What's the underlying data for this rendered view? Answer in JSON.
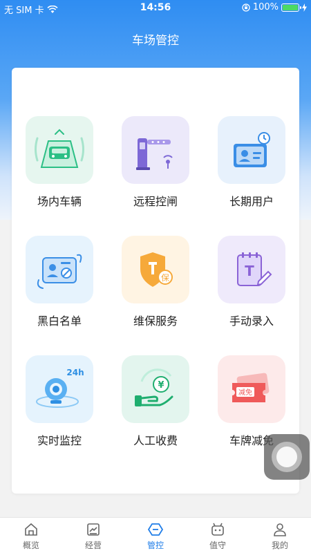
{
  "status_bar": {
    "carrier": "无 SIM 卡",
    "time": "14:56",
    "battery_percent": "100%",
    "battery_level": 1.0
  },
  "header": {
    "title": "车场管控"
  },
  "grid": [
    {
      "label": "场内车辆",
      "icon": "car-in-lot-icon",
      "color": "#e6f6ef"
    },
    {
      "label": "远程控闸",
      "icon": "remote-gate-icon",
      "color": "#ece9fa"
    },
    {
      "label": "长期用户",
      "icon": "long-term-user-icon",
      "color": "#e7f1fc"
    },
    {
      "label": "黑白名单",
      "icon": "blacklist-card-icon",
      "color": "#e6f3fd"
    },
    {
      "label": "维保服务",
      "icon": "maintenance-shield-icon",
      "color": "#fff4e3"
    },
    {
      "label": "手动录入",
      "icon": "manual-entry-icon",
      "color": "#efeafb"
    },
    {
      "label": "实时监控",
      "icon": "camera-24h-icon",
      "color": "#e5f3fd",
      "badge": "24h"
    },
    {
      "label": "人工收费",
      "icon": "manual-charge-icon",
      "color": "#e3f5ee",
      "badge": "¥"
    },
    {
      "label": "车牌减免",
      "icon": "plate-discount-icon",
      "color": "#fdeaea",
      "badge": "减免"
    }
  ],
  "maintenance_badge": "保",
  "manual_entry_badge": "T",
  "tabs": [
    {
      "label": "概览",
      "icon": "home-icon",
      "active": false
    },
    {
      "label": "经营",
      "icon": "chart-icon",
      "active": false
    },
    {
      "label": "管控",
      "icon": "control-icon",
      "active": true
    },
    {
      "label": "值守",
      "icon": "robot-icon",
      "active": false
    },
    {
      "label": "我的",
      "icon": "user-icon",
      "active": false
    }
  ],
  "colors": {
    "primary": "#1f7de8",
    "header_gradient_top": "#2f8df2"
  }
}
